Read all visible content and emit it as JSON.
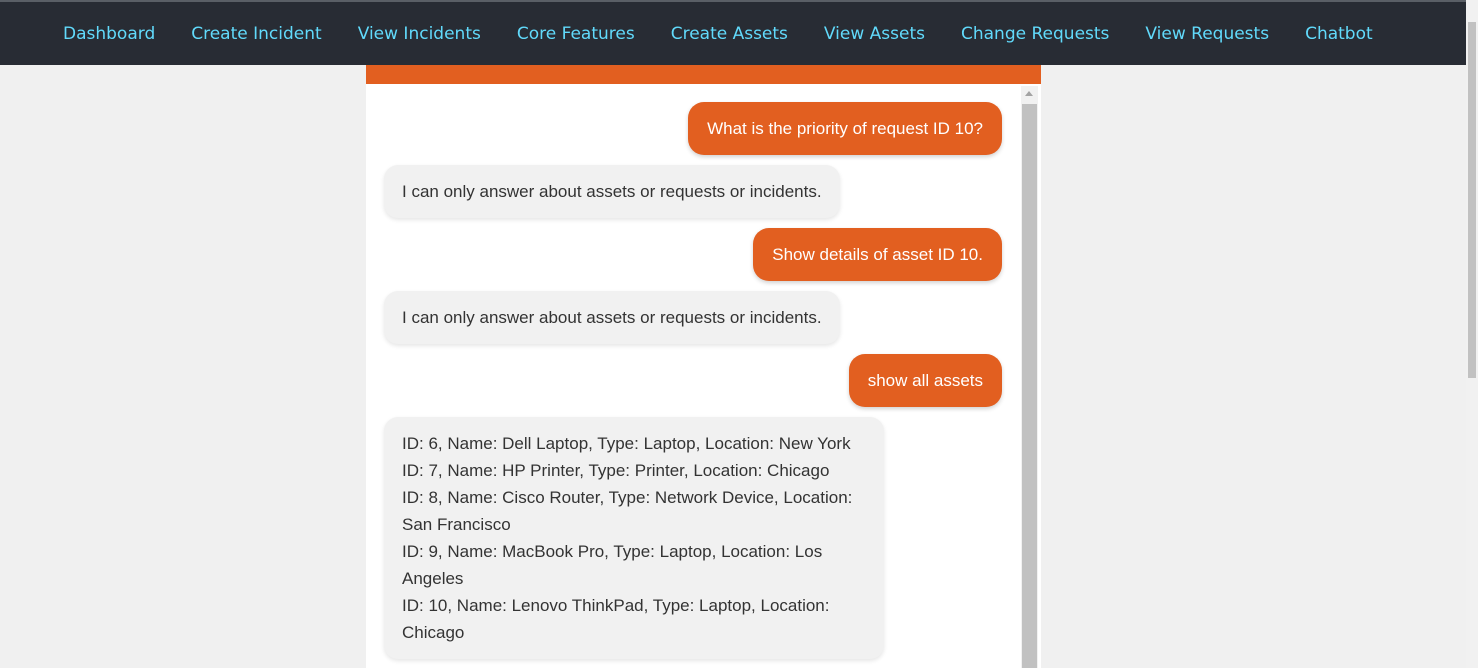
{
  "nav": {
    "items": [
      {
        "label": "Dashboard"
      },
      {
        "label": "Create Incident"
      },
      {
        "label": "View Incidents"
      },
      {
        "label": "Core Features"
      },
      {
        "label": "Create Assets"
      },
      {
        "label": "View Assets"
      },
      {
        "label": "Change Requests"
      },
      {
        "label": "View Requests"
      },
      {
        "label": "Chatbot"
      }
    ]
  },
  "chat": {
    "messages": [
      {
        "role": "user",
        "text": "What is the priority of request ID 10?"
      },
      {
        "role": "bot",
        "text": "I can only answer about assets or requests or incidents."
      },
      {
        "role": "user",
        "text": "Show details of asset ID 10."
      },
      {
        "role": "bot",
        "text": "I can only answer about assets or requests or incidents."
      },
      {
        "role": "user",
        "text": "show all assets"
      },
      {
        "role": "bot",
        "lines": [
          "ID: 6, Name: Dell Laptop, Type: Laptop, Location: New York",
          "ID: 7, Name: HP Printer, Type: Printer, Location: Chicago",
          "ID: 8, Name: Cisco Router, Type: Network Device, Location: San Francisco",
          "ID: 9, Name: MacBook Pro, Type: Laptop, Location: Los Angeles",
          "ID: 10, Name: Lenovo ThinkPad, Type: Laptop, Location: Chicago"
        ]
      }
    ]
  },
  "colors": {
    "navbar_bg": "#282c34",
    "nav_link": "#61dafb",
    "accent": "#e25f20",
    "bot_bubble": "#f1f1f1"
  }
}
